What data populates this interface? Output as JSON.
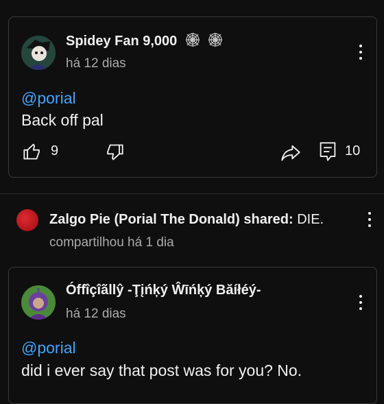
{
  "comment1": {
    "author": "Spidey Fan 9,000",
    "badges": [
      "spider-web-icon",
      "spider-web-icon"
    ],
    "time": "há 12 dias",
    "mention": "@porial",
    "text": "Back off pal",
    "likes": "9",
    "replies": "10"
  },
  "shared": {
    "author": "Zalgo Pie (Porial The Donald)",
    "action": "shared:",
    "title": "DIE.",
    "time": "compartilhou há 1 dia"
  },
  "comment2": {
    "author": "Óffîçîãllŷ -Ţįńķý Ŵīńķý Băíłéý-",
    "time": "há 12 dias",
    "mention": "@porial",
    "text": "did i ever say that post was for you? No."
  },
  "colors": {
    "background": "#0f0f0f",
    "mention": "#3ea6ff",
    "secondary_text": "#aaaaaa",
    "card_border": "#3a3a3a",
    "shared_avatar": "#c8141e"
  }
}
